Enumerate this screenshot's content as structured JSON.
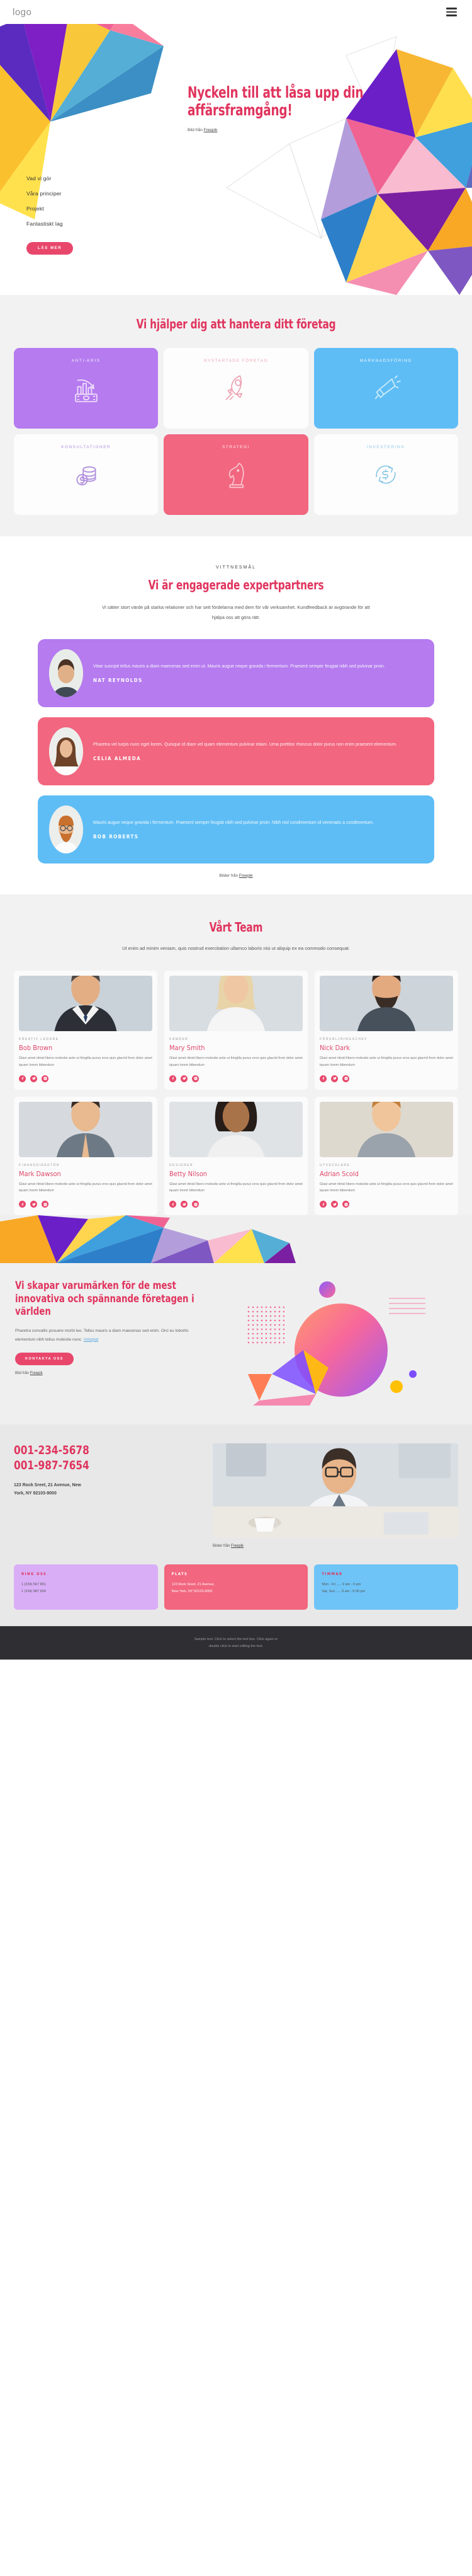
{
  "header": {
    "logo": "logo",
    "menu_icon": "hamburger-menu-icon"
  },
  "hero": {
    "title": "Nyckeln till att låsa upp din affärsframgång!",
    "credit_prefix": "Bild från ",
    "credit_link": "Freepik",
    "nav": [
      {
        "label": "Vad vi gör"
      },
      {
        "label": "Våra principer"
      },
      {
        "label": "Projekt"
      },
      {
        "label": "Fantastiskt lag"
      }
    ],
    "cta": "LÄS MER"
  },
  "services": {
    "title": "Vi hjälper dig att hantera ditt företag",
    "cards": [
      {
        "label": "ANTI-KRIS",
        "icon": "money-chart-icon",
        "theme": "purple"
      },
      {
        "label": "NYSTARTADE FÖRETAG",
        "icon": "rocket-icon",
        "theme": "white-pink"
      },
      {
        "label": "MARKNADSFÖRING",
        "icon": "megaphone-icon",
        "theme": "blue"
      },
      {
        "label": "KONSULTATIONER",
        "icon": "coins-dollar-icon",
        "theme": "white-purple"
      },
      {
        "label": "STRATEGI",
        "icon": "chess-knight-icon",
        "theme": "pink"
      },
      {
        "label": "INVESTERING",
        "icon": "dollar-refresh-icon",
        "theme": "white-blue"
      }
    ]
  },
  "testimonials": {
    "eyebrow": "VITTNESMÅL",
    "title": "Vi är engagerade expertpartners",
    "subtitle": "Vi sätter stort värde på starka relationer och har sett fördelarna med dem för vår verksamhet. Kundfeedback är avgörande för att hjälpa oss att göra rätt.",
    "credit_prefix": "Bilder från ",
    "credit_link": "Freepik",
    "items": [
      {
        "text": "Vitae suscipit tellus mauris a diam maecenas sed enim ut. Mauris augue neque gravida i fermentum. Praesent semper feugiat nibh sed pulvinar proin.",
        "name": "NAT REYNOLDS",
        "theme": "purple"
      },
      {
        "text": "Pharetra vel turpis nunc eget lorem. Quisque id diam vel quam elementum pulvinar etiam. Urna porttitor rhoncus dolor purus non enim praesent elementum.",
        "name": "CELIA ALMEDA",
        "theme": "pink"
      },
      {
        "text": "Mauris augue neque gravida i fermentum. Praesent semper feugiat nibh sed pulvinar proin. Nibh nisl condimentum id venenatis a condimentum.",
        "name": "BOB ROBERTS",
        "theme": "blue"
      }
    ]
  },
  "team": {
    "title": "Vårt Team",
    "subtitle": "Ut enim ad minim veniam, quis nostrud exercitation ullamco laboris nisi ut aliquip ex ea commodo consequat.",
    "bio": "Glavi amet ritnisl libero molestie ante ut fringilla purus eros quis glavrid from dolor amet iquam lorem bibendum",
    "socials": [
      "facebook-icon",
      "twitter-icon",
      "instagram-icon"
    ],
    "members": [
      {
        "role": "KREATIV LEDARE",
        "name": "Bob Brown"
      },
      {
        "role": "KAMRER",
        "name": "Mary Smith"
      },
      {
        "role": "FÖRSÄLJNINGSCHEF",
        "name": "Nick Dark"
      },
      {
        "role": "FINANSDIREKTÖR",
        "name": "Mark Dawson"
      },
      {
        "role": "DESIGNER",
        "name": "Betty Nilson"
      },
      {
        "role": "UTVECKLARE",
        "name": "Adrian Scold"
      }
    ]
  },
  "brand": {
    "title": "Vi skapar varumärken för de mest innovativa och spännande företagen i världen",
    "paragraph": "Pharetra convallis posuere morbi leo. Tellus mauris a diam maecenas sed enim. Orci eu lobortis elementum nibh tellus molestie nunc. ",
    "paragraph_link": "Volutpat",
    "cta": "KONTAKTA OSS",
    "credit_prefix": "Bild från ",
    "credit_link": "Freepik"
  },
  "contact": {
    "phone_1": "001-234-5678",
    "phone_2": "001-987-7654",
    "address_line_1": "123 Rock Sreet, 21 Avenue, New",
    "address_line_2": "York, NY 92103-9000",
    "credit_prefix": "Bilder från ",
    "credit_link": "Freepik",
    "cards": [
      {
        "title": "RING OSS",
        "lines": [
          "1 (234) 567 891",
          "1 (234) 987 654"
        ],
        "theme": "purple"
      },
      {
        "title": "PLATS",
        "lines": [
          "123 Rock Sreet, 21 Avenue,",
          "New York, NY 92103-9000"
        ],
        "theme": "pink"
      },
      {
        "title": "TIMMAR",
        "lines": [
          "Mon - Fri ..... 9 am - 6 pm",
          "Sat, Sun ..... 9 am - 6:30 pm"
        ],
        "theme": "blue"
      }
    ]
  },
  "footer": {
    "line_1": "Sample text. Click to select the text box. Click again or",
    "line_2": "double click to start editing the text."
  },
  "colors": {
    "accent_pink": "#e0355e",
    "btn_pink": "#e8476b",
    "purple": "#b57bef",
    "blue": "#5fbdf5",
    "card_pink": "#f2667f"
  }
}
